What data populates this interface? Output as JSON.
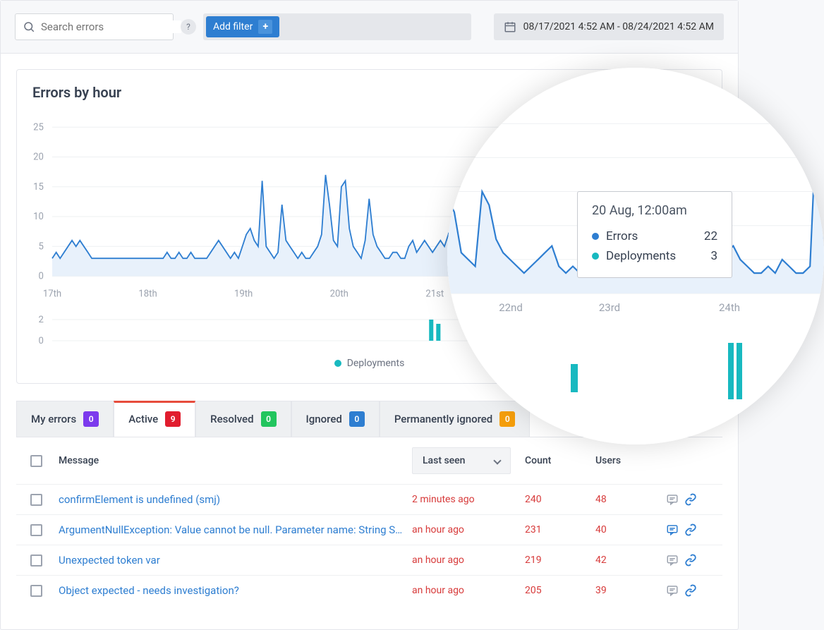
{
  "topbar": {
    "search_placeholder": "Search errors",
    "add_filter_label": "Add filter",
    "date_range": "08/17/2021 4:52 AM - 08/24/2021 4:52 AM"
  },
  "chart": {
    "title": "Errors by hour",
    "deploy_label": "Deployments"
  },
  "tooltip": {
    "date": "20 Aug, 12:00am",
    "rows": [
      {
        "label": "Errors",
        "value": "22",
        "color": "#2e7ed1"
      },
      {
        "label": "Deployments",
        "value": "3",
        "color": "#18b9c0"
      }
    ]
  },
  "tabs": [
    {
      "label": "My errors",
      "count": "0",
      "color": "#7c3aed"
    },
    {
      "label": "Active",
      "count": "9",
      "color": "#e11d2e"
    },
    {
      "label": "Resolved",
      "count": "0",
      "color": "#22c55e"
    },
    {
      "label": "Ignored",
      "count": "0",
      "color": "#2e7ed1"
    },
    {
      "label": "Permanently ignored",
      "count": "0",
      "color": "#f59e0b"
    }
  ],
  "table": {
    "headers": {
      "message": "Message",
      "last_seen": "Last seen",
      "count": "Count",
      "users": "Users"
    },
    "rows": [
      {
        "message": "confirmElement is undefined (smj)",
        "last_seen": "2 minutes ago",
        "count": "240",
        "users": "48",
        "comment_active": false
      },
      {
        "message": "ArgumentNullException: Value cannot be null. Parameter name: String S…",
        "last_seen": "an hour ago",
        "count": "231",
        "users": "40",
        "comment_active": true
      },
      {
        "message": "Unexpected token var",
        "last_seen": "an hour ago",
        "count": "219",
        "users": "42",
        "comment_active": false
      },
      {
        "message": "Object expected - needs investigation?",
        "last_seen": "an hour ago",
        "count": "205",
        "users": "39",
        "comment_active": false
      }
    ]
  },
  "chart_data": {
    "type": "line",
    "title": "Errors by hour",
    "ylabel": "",
    "ylim": [
      0,
      27
    ],
    "yticks": [
      0,
      5,
      10,
      15,
      20,
      25
    ],
    "x_categories": [
      "17th",
      "18th",
      "19th",
      "20th",
      "21st",
      "22nd",
      "23rd",
      "24th"
    ],
    "series": [
      {
        "name": "Errors",
        "color": "#2e7ed1",
        "points_per_day": 24,
        "values": [
          3,
          4,
          3,
          4,
          5,
          6,
          5,
          6,
          5,
          4,
          3,
          3,
          3,
          3,
          3,
          3,
          3,
          3,
          3,
          3,
          3,
          3,
          3,
          3,
          3,
          3,
          3,
          3,
          3,
          4,
          3,
          3,
          4,
          3,
          3,
          4,
          3,
          3,
          3,
          3,
          4,
          5,
          6,
          5,
          4,
          3,
          4,
          3,
          5,
          7,
          8,
          6,
          5,
          16,
          5,
          4,
          3,
          4,
          12,
          6,
          5,
          4,
          3,
          4,
          3,
          3,
          4,
          5,
          7,
          17,
          12,
          6,
          5,
          15,
          16,
          8,
          5,
          4,
          3,
          6,
          13,
          7,
          5,
          4,
          3,
          3,
          4,
          4,
          3,
          3,
          5,
          6,
          4,
          5,
          6,
          5,
          4,
          5,
          6,
          5,
          7,
          4,
          3,
          4,
          3,
          3,
          4,
          5,
          4,
          3,
          4,
          3,
          4,
          5,
          6,
          14,
          12,
          6,
          5,
          4,
          15,
          13,
          8,
          6,
          5,
          4,
          3,
          4,
          5,
          6,
          7,
          4,
          3,
          4,
          3,
          3,
          4,
          5,
          4,
          3,
          3,
          4,
          3,
          3,
          4,
          5,
          4,
          3,
          3,
          4,
          3,
          3,
          3,
          4,
          5,
          6,
          7,
          5,
          4,
          3,
          3,
          4,
          3,
          5,
          4,
          3,
          3,
          4,
          27,
          8
        ]
      }
    ],
    "deployments": {
      "type": "bar",
      "ylim": [
        0,
        2
      ],
      "yticks": [
        0,
        2
      ],
      "values_by_day": {
        "17th": 0,
        "18th": 0,
        "19th": 0,
        "20th": 0,
        "21st": 2,
        "22nd": 0,
        "23rd": 0,
        "24th": 0
      }
    }
  }
}
